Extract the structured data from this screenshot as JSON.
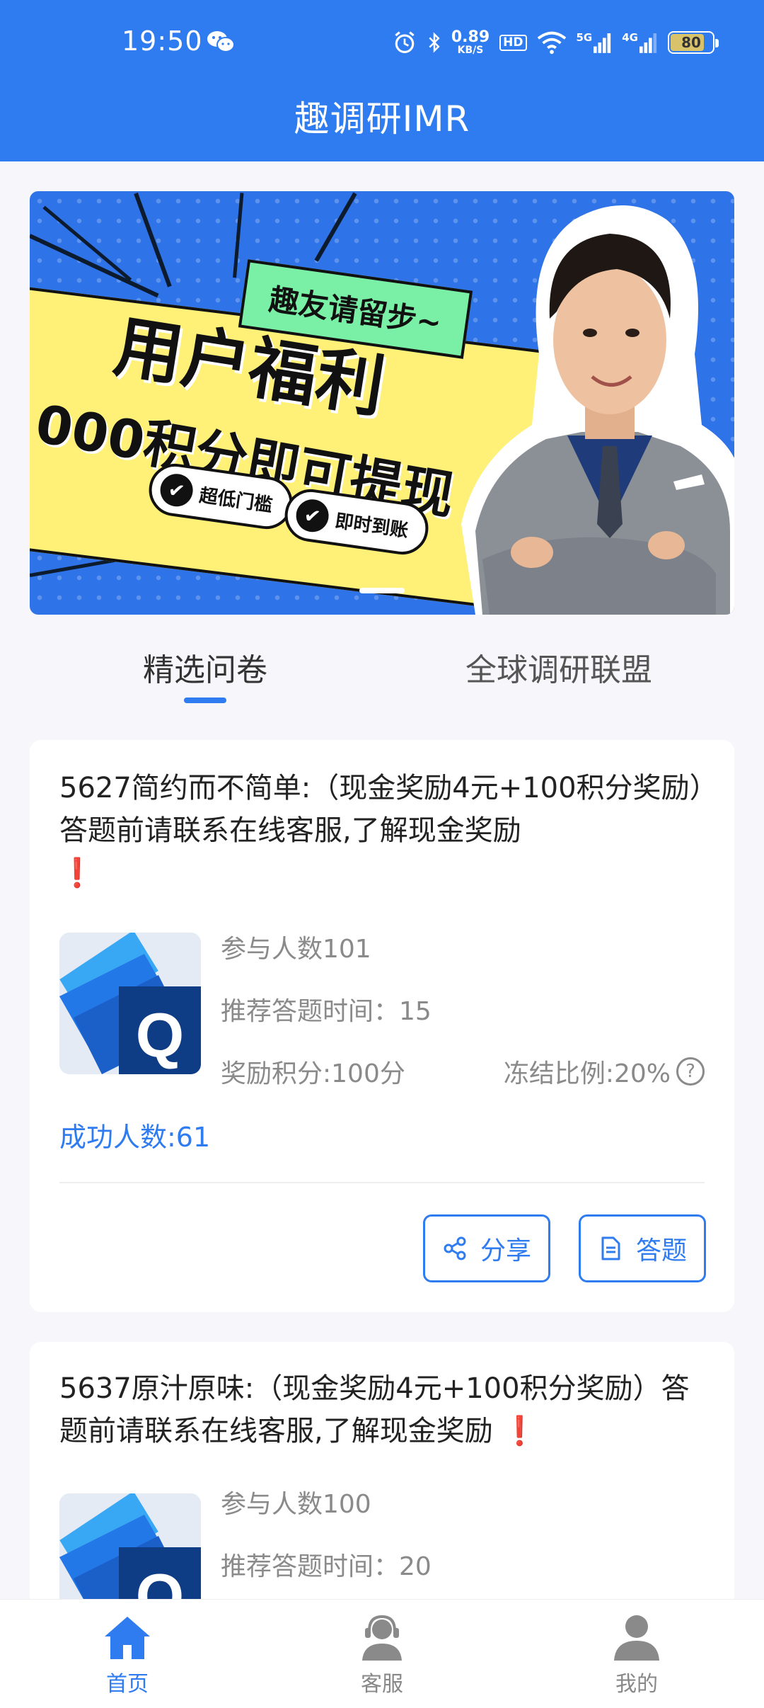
{
  "status_bar": {
    "time": "19:50",
    "net_speed_value": "0.89",
    "net_speed_unit": "KB/S",
    "hd_label": "HD",
    "net1_label": "5G",
    "net2_label": "4G",
    "battery": "80"
  },
  "header": {
    "title": "趣调研IMR"
  },
  "banner": {
    "tag": "趣友请留步~",
    "headline": "用户福利",
    "subline": "000积分即可提现",
    "pill1": "超低门槛",
    "pill2": "即时到账"
  },
  "tabs": [
    {
      "label": "精选问卷",
      "active": true
    },
    {
      "label": "全球调研联盟",
      "active": false
    }
  ],
  "surveys": [
    {
      "title": "5627简约而不简单:（现金奖励4元+100积分奖励）答题前请联系在线客服,了解现金奖励",
      "bang": "❗",
      "participants": "参与人数101",
      "time": "推荐答题时间：15",
      "points": "奖励积分:100分",
      "freeze": "冻结比例:20%",
      "success": "成功人数:61",
      "share_label": "分享",
      "answer_label": "答题"
    },
    {
      "title": "5637原汁原味:（现金奖励4元+100积分奖励）答题前请联系在线客服,了解现金奖励",
      "bang": "❗",
      "participants": "参与人数100",
      "time": "推荐答题时间：20"
    }
  ],
  "bottom_nav": [
    {
      "label": "首页",
      "icon": "home-icon",
      "active": true
    },
    {
      "label": "客服",
      "icon": "customer-service-icon",
      "active": false
    },
    {
      "label": "我的",
      "icon": "user-icon",
      "active": false
    }
  ],
  "colors": {
    "primary": "#2f7bf0",
    "alert": "#e03131",
    "muted": "#8a8a8a"
  }
}
